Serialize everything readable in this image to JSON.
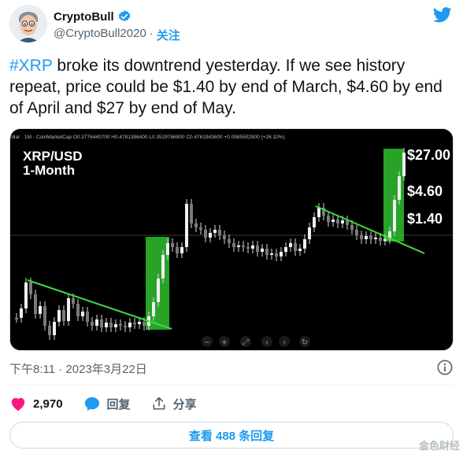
{
  "author": {
    "display_name": "CryptoBull",
    "handle": "@CryptoBull2020",
    "separator": "·",
    "follow_label": "关注"
  },
  "tweet": {
    "hashtag": "#XRP",
    "text": " broke its downtrend yesterday. If we see history repeat, price could be $1.40 by end of March, $4.60 by end of April and $27 by end of May."
  },
  "chart": {
    "header_text": "ollar · 1M · CoinMarketCap  O0.3776440700 H0.4781386400 L0.3529786900 C0.4761943600 +0.0985502900 (+26.10%)",
    "title_line1": "XRP/USD",
    "title_line2": "1-Month",
    "target_labels": [
      "$27.00",
      "$4.60",
      "$1.40"
    ],
    "toolbar": [
      "−",
      "+",
      "⤢",
      "‹",
      "›",
      "↻"
    ],
    "colors": {
      "background": "#000000",
      "trendline": "#3fdc3f",
      "highlight": "#2fbf2f",
      "candles": "#e6e6e6"
    }
  },
  "timestamp": "下午8:11 · 2023年3月22日",
  "actions": {
    "like_count": "2,970",
    "reply_label": "回复",
    "share_label": "分享"
  },
  "replies_button": "查看 488 条回复",
  "watermark": "金色财经"
}
